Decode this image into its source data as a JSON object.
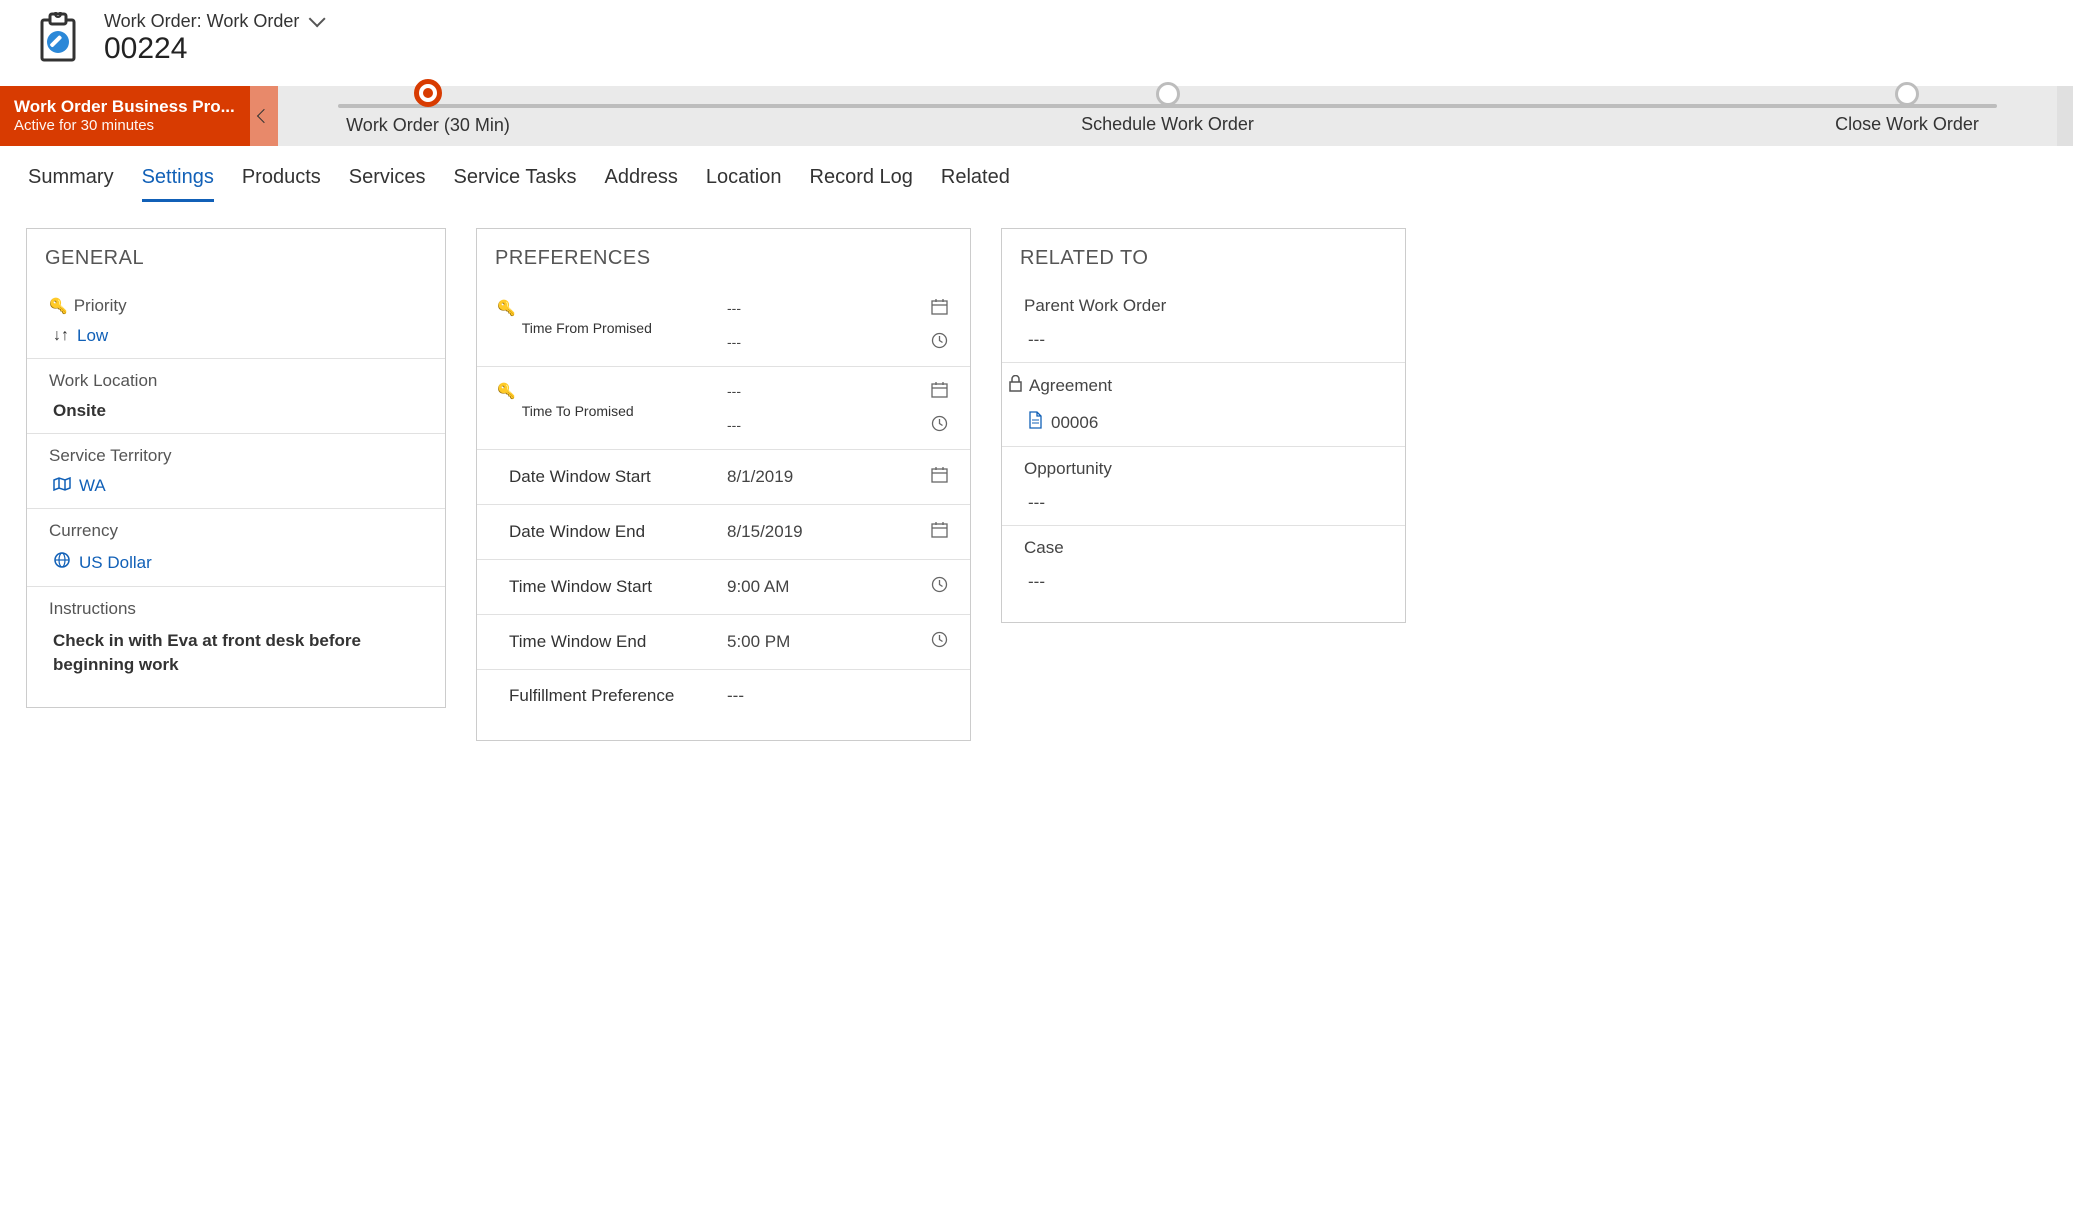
{
  "header": {
    "breadcrumb": "Work Order: Work Order",
    "record_id": "00224"
  },
  "process": {
    "name": "Work Order Business Pro...",
    "status": "Active for 30 minutes",
    "stages": [
      {
        "label": "Work Order  (30 Min)",
        "active": true
      },
      {
        "label": "Schedule Work Order",
        "active": false
      },
      {
        "label": "Close Work Order",
        "active": false
      }
    ]
  },
  "tabs": [
    {
      "label": "Summary",
      "active": false
    },
    {
      "label": "Settings",
      "active": true
    },
    {
      "label": "Products",
      "active": false
    },
    {
      "label": "Services",
      "active": false
    },
    {
      "label": "Service Tasks",
      "active": false
    },
    {
      "label": "Address",
      "active": false
    },
    {
      "label": "Location",
      "active": false
    },
    {
      "label": "Record Log",
      "active": false
    },
    {
      "label": "Related",
      "active": false
    }
  ],
  "general": {
    "title": "GENERAL",
    "priority_label": "Priority",
    "priority_value": "Low",
    "work_location_label": "Work Location",
    "work_location_value": "Onsite",
    "service_territory_label": "Service Territory",
    "service_territory_value": "WA",
    "currency_label": "Currency",
    "currency_value": "US Dollar",
    "instructions_label": "Instructions",
    "instructions_value": "Check in with Eva at front desk before beginning work"
  },
  "preferences": {
    "title": "PREFERENCES",
    "time_from_promised_label": "Time From Promised",
    "time_from_promised_date": "---",
    "time_from_promised_time": "---",
    "time_to_promised_label": "Time To Promised",
    "time_to_promised_date": "---",
    "time_to_promised_time": "---",
    "date_window_start_label": "Date Window Start",
    "date_window_start_value": "8/1/2019",
    "date_window_end_label": "Date Window End",
    "date_window_end_value": "8/15/2019",
    "time_window_start_label": "Time Window Start",
    "time_window_start_value": "9:00 AM",
    "time_window_end_label": "Time Window End",
    "time_window_end_value": "5:00 PM",
    "fulfillment_preference_label": "Fulfillment Preference",
    "fulfillment_preference_value": "---"
  },
  "related": {
    "title": "RELATED TO",
    "parent_work_order_label": "Parent Work Order",
    "parent_work_order_value": "---",
    "agreement_label": "Agreement",
    "agreement_value": "00006",
    "opportunity_label": "Opportunity",
    "opportunity_value": "---",
    "case_label": "Case",
    "case_value": "---"
  }
}
